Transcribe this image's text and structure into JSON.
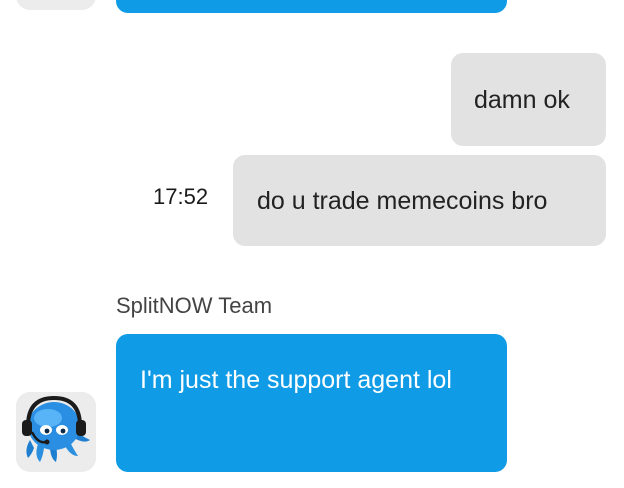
{
  "messages": [
    {
      "from": "user",
      "text": "damn ok"
    },
    {
      "from": "user",
      "text": "do u trade memecoins bro",
      "time": "17:52"
    },
    {
      "from": "agent",
      "sender": "SplitNOW Team",
      "text": "I'm just the support agent lol",
      "avatar_icon": "octopus-support-agent-icon"
    }
  ],
  "colors": {
    "agent_bubble": "#0f9be6",
    "user_bubble": "#e2e2e2",
    "avatar_bg": "#ececec"
  }
}
